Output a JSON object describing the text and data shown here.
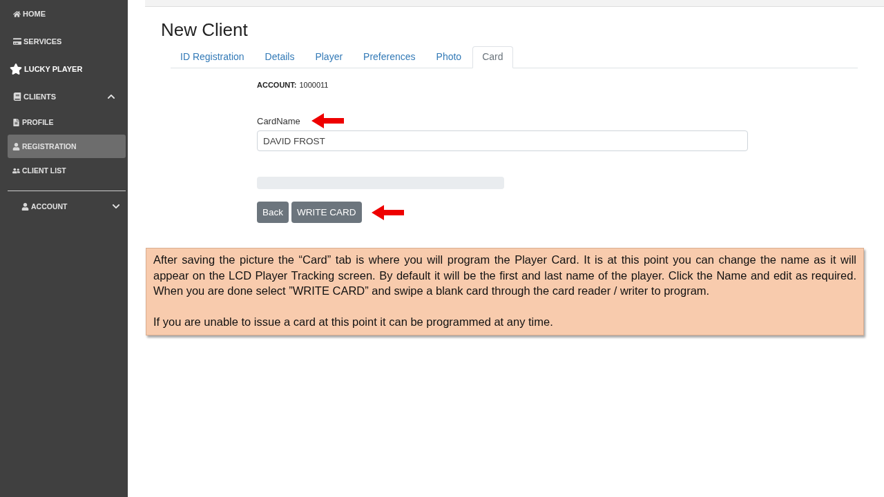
{
  "sidebar": {
    "items": [
      {
        "label": "HOME",
        "selected": false
      },
      {
        "label": "SERVICES",
        "selected": false
      },
      {
        "label": "LUCKY PLAYER",
        "selected": false
      },
      {
        "label": "CLIENTS",
        "selected": false,
        "expanded": true,
        "children": [
          {
            "label": "PROFILE",
            "selected": false
          },
          {
            "label": "REGISTRATION",
            "selected": true
          },
          {
            "label": "CLIENT LIST",
            "selected": false
          }
        ]
      }
    ],
    "account": {
      "label": "ACCOUNT",
      "expanded": false
    }
  },
  "page": {
    "title": "New Client"
  },
  "tabs": [
    {
      "label": "ID Registration",
      "selected": false
    },
    {
      "label": "Details",
      "selected": false
    },
    {
      "label": "Player",
      "selected": false
    },
    {
      "label": "Preferences",
      "selected": false
    },
    {
      "label": "Photo",
      "selected": false
    },
    {
      "label": "Card",
      "selected": true
    }
  ],
  "form": {
    "account": {
      "label": "ACCOUNT:",
      "value": "1000011"
    },
    "card_name": {
      "label": "CardName",
      "value": "DAVID FROST"
    },
    "progress": {
      "level": 0
    },
    "buttons": [
      "Back",
      "WRITE CARD"
    ]
  },
  "note": {
    "paragraphs": [
      "After saving the picture the “Card” tab is where you will program the Player Card. It is at this point you can change the name as it will appear on the LCD Player Tracking screen. By default it will be the first and last name of the player. Click the Name and edit as required. When you are done select ”WRITE CARD” and swipe a blank card through the card reader / writer to program.",
      "If you are unable to issue a card at this point it can be programmed at any time."
    ]
  }
}
